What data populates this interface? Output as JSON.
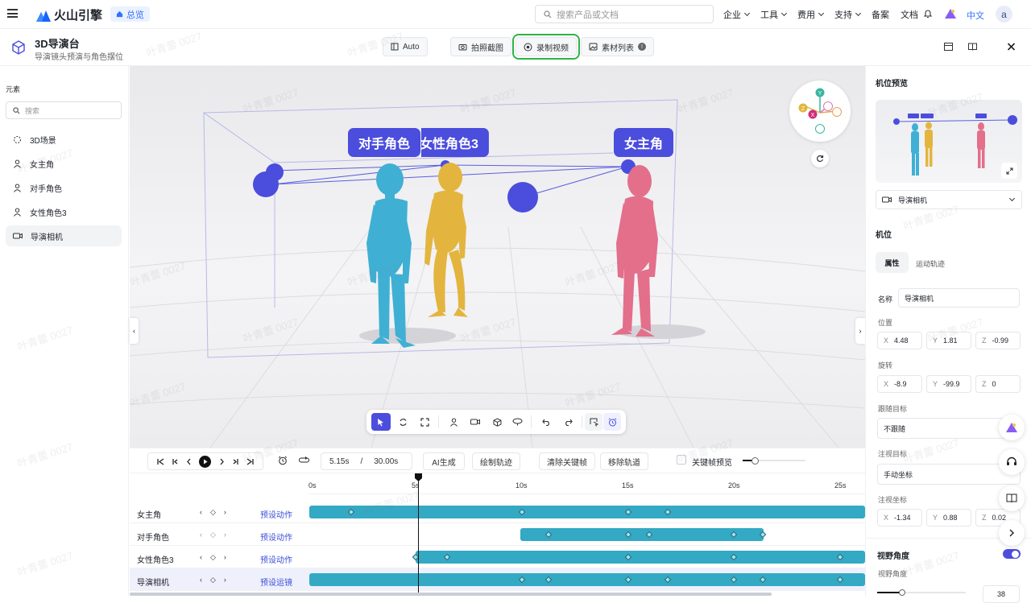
{
  "topnav": {
    "brand": "火山引擎",
    "home_badge": "总览",
    "search_placeholder": "搜索产品或文档",
    "links": [
      "企业",
      "工具",
      "费用",
      "支持",
      "备案",
      "文档"
    ],
    "lang": "中文",
    "avatar": "a"
  },
  "subheader": {
    "title": "3D导演台",
    "subtitle": "导演镜头预演与角色摆位",
    "buttons": {
      "auto": "Auto",
      "screenshot": "拍照截图",
      "record": "录制视频",
      "assets": "素材列表",
      "assets_badge": "!"
    }
  },
  "left_panel": {
    "title": "元素",
    "search_placeholder": "搜索",
    "items": [
      {
        "label": "3D场景",
        "icon": "scene-icon"
      },
      {
        "label": "女主角",
        "icon": "person-icon"
      },
      {
        "label": "对手角色",
        "icon": "person-icon"
      },
      {
        "label": "女性角色3",
        "icon": "person-icon"
      },
      {
        "label": "导演相机",
        "icon": "camera-icon"
      }
    ]
  },
  "viewport": {
    "labels": [
      "对手角色",
      "女性角色3",
      "女主角"
    ],
    "gizmo_axes": [
      "Y",
      "Z",
      "X"
    ],
    "figure_colors": {
      "opponent": "#3fb0d4",
      "female3": "#e3b53f",
      "lead": "#e36f8a"
    },
    "accent": "#4b4ddd"
  },
  "playback": {
    "current_time": "5.15s",
    "separator": "/",
    "total_time": "30.00s",
    "buttons": [
      "AI生成",
      "绘制轨迹",
      "清除关键帧",
      "移除轨道"
    ],
    "keyframe_preview": "关键帧预览"
  },
  "timeline": {
    "ticks": [
      "0s",
      "5s",
      "10s",
      "15s",
      "20s",
      "25s"
    ],
    "rows": [
      {
        "name": "女主角",
        "preset": "预设动作"
      },
      {
        "name": "对手角色",
        "preset": "预设动作"
      },
      {
        "name": "女性角色3",
        "preset": "预设动作"
      },
      {
        "name": "导演相机",
        "preset": "预设运镜"
      }
    ]
  },
  "right_panel": {
    "preview_title": "机位预览",
    "camera_select": "导演相机",
    "section": "机位",
    "tabs": [
      "属性",
      "运动轨迹"
    ],
    "name_label": "名称",
    "name_value": "导演相机",
    "position_label": "位置",
    "position": {
      "x": "4.48",
      "y": "1.81",
      "z": "-0.99"
    },
    "rotation_label": "旋转",
    "rotation": {
      "x": "-8.9",
      "y": "-99.9",
      "z": "0"
    },
    "follow_label": "跟随目标",
    "follow_value": "不跟随",
    "gaze_label": "注视目标",
    "gaze_value": "手动坐标",
    "gaze_coord_label": "注视坐标",
    "gaze_coord": {
      "x": "-1.34",
      "y": "0.88",
      "z": "0.02"
    },
    "fov_section": "视野角度",
    "fov_label": "视野角度",
    "fov_value": "38"
  },
  "watermark": "叶青蕾 0027"
}
